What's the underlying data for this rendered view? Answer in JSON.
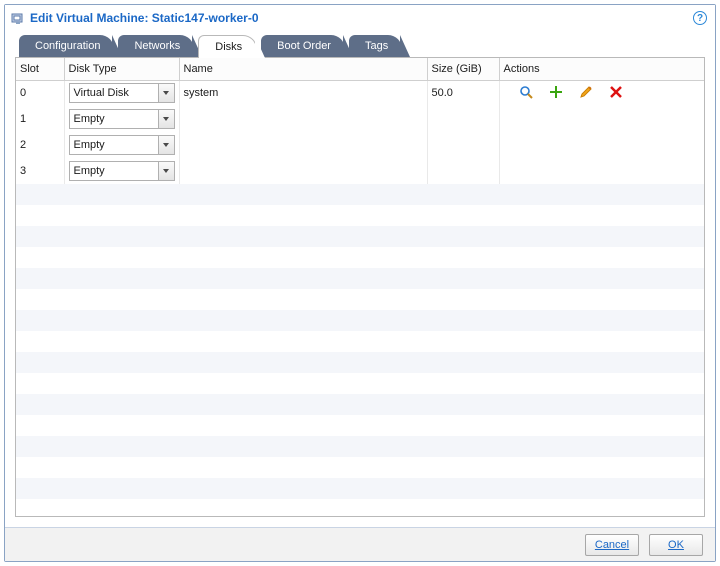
{
  "dialog": {
    "title": "Edit Virtual Machine: Static147-worker-0"
  },
  "tabs": [
    {
      "id": "configuration",
      "label": "Configuration",
      "active": false
    },
    {
      "id": "networks",
      "label": "Networks",
      "active": false
    },
    {
      "id": "disks",
      "label": "Disks",
      "active": true
    },
    {
      "id": "boot-order",
      "label": "Boot Order",
      "active": false
    },
    {
      "id": "tags",
      "label": "Tags",
      "active": false
    }
  ],
  "grid": {
    "columns": {
      "slot": "Slot",
      "disk_type": "Disk Type",
      "name": "Name",
      "size": "Size (GiB)",
      "actions": "Actions"
    },
    "rows": [
      {
        "slot": "0",
        "disk_type": "Virtual Disk",
        "name": "system",
        "size": "50.0",
        "has_actions": true
      },
      {
        "slot": "1",
        "disk_type": "Empty",
        "name": "",
        "size": "",
        "has_actions": false
      },
      {
        "slot": "2",
        "disk_type": "Empty",
        "name": "",
        "size": "",
        "has_actions": false
      },
      {
        "slot": "3",
        "disk_type": "Empty",
        "name": "",
        "size": "",
        "has_actions": false
      }
    ]
  },
  "actions": {
    "view": "view-icon",
    "add": "add-icon",
    "edit": "edit-icon",
    "delete": "delete-icon"
  },
  "footer": {
    "cancel": "Cancel",
    "ok": "OK"
  }
}
